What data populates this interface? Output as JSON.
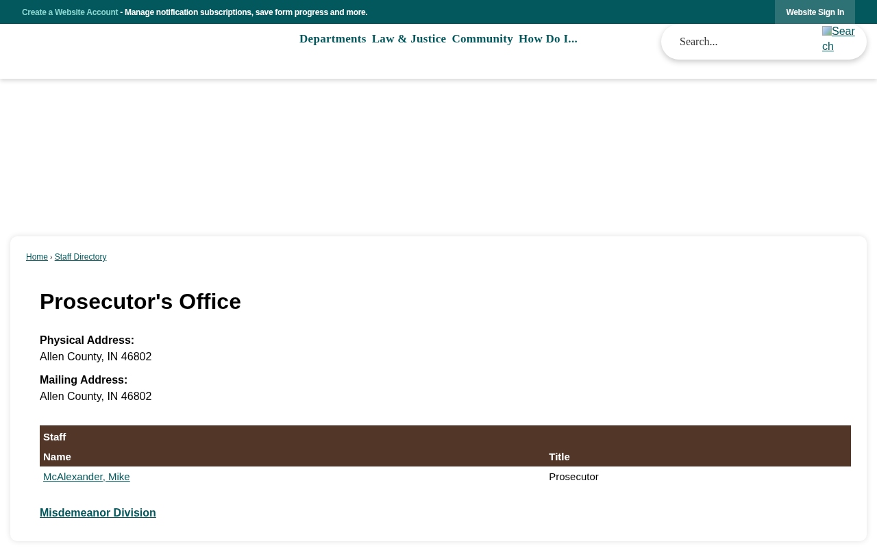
{
  "top_bar": {
    "account_link": "Create a Website Account",
    "message": " - Manage notification subscriptions, save form progress and more.",
    "sign_in": "Website Sign In"
  },
  "nav": [
    {
      "label": "Departments"
    },
    {
      "label": "Law & Justice"
    },
    {
      "label": "Community"
    },
    {
      "label": "How Do I..."
    }
  ],
  "search": {
    "placeholder": "Search...",
    "button_alt": "Search"
  },
  "breadcrumb": [
    {
      "label": "Home"
    },
    {
      "label": "Staff Directory"
    }
  ],
  "breadcrumb_separator": "›",
  "page": {
    "title": "Prosecutor's Office",
    "addresses": [
      {
        "label": "Physical Address:",
        "value": "Allen County, IN 46802"
      },
      {
        "label": "Mailing Address:",
        "value": "Allen County, IN 46802"
      }
    ],
    "table": {
      "caption": "Staff",
      "columns": [
        "Name",
        "Title"
      ],
      "rows": [
        [
          "McAlexander, Mike",
          "Prosecutor"
        ]
      ]
    },
    "next_section": "Misdemeanor Division"
  }
}
